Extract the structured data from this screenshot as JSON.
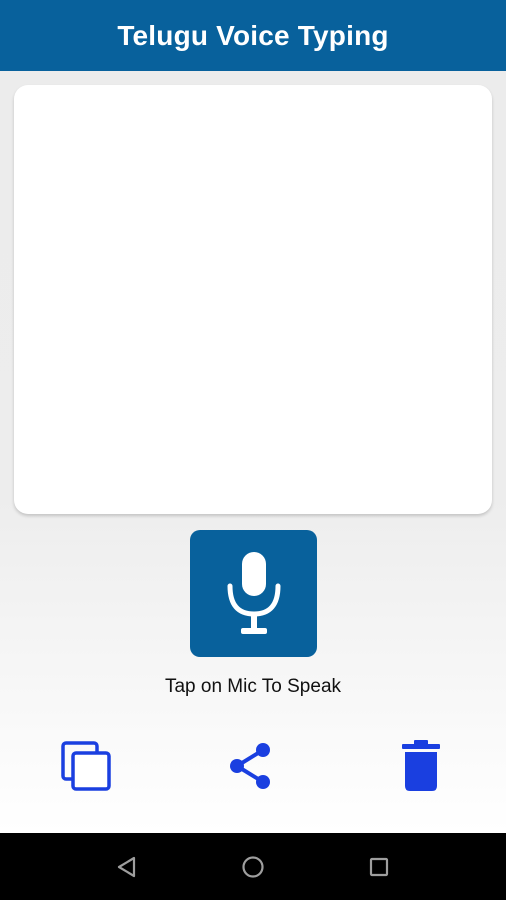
{
  "app": {
    "title": "Telugu Voice Typing"
  },
  "editor": {
    "text": ""
  },
  "mic": {
    "icon": "mic-icon",
    "hint": "Tap on Mic To Speak"
  },
  "actions": [
    {
      "name": "copy",
      "icon": "copy-icon"
    },
    {
      "name": "share",
      "icon": "share-icon"
    },
    {
      "name": "delete",
      "icon": "trash-icon"
    }
  ],
  "nav": {
    "back_icon": "back-triangle-icon",
    "home_icon": "home-circle-icon",
    "recents_icon": "recents-square-icon"
  },
  "colors": {
    "primary": "#08619c",
    "action_blue": "#1a3fe0",
    "nav_bar": "#000000",
    "nav_icon": "#9e9e9e"
  }
}
